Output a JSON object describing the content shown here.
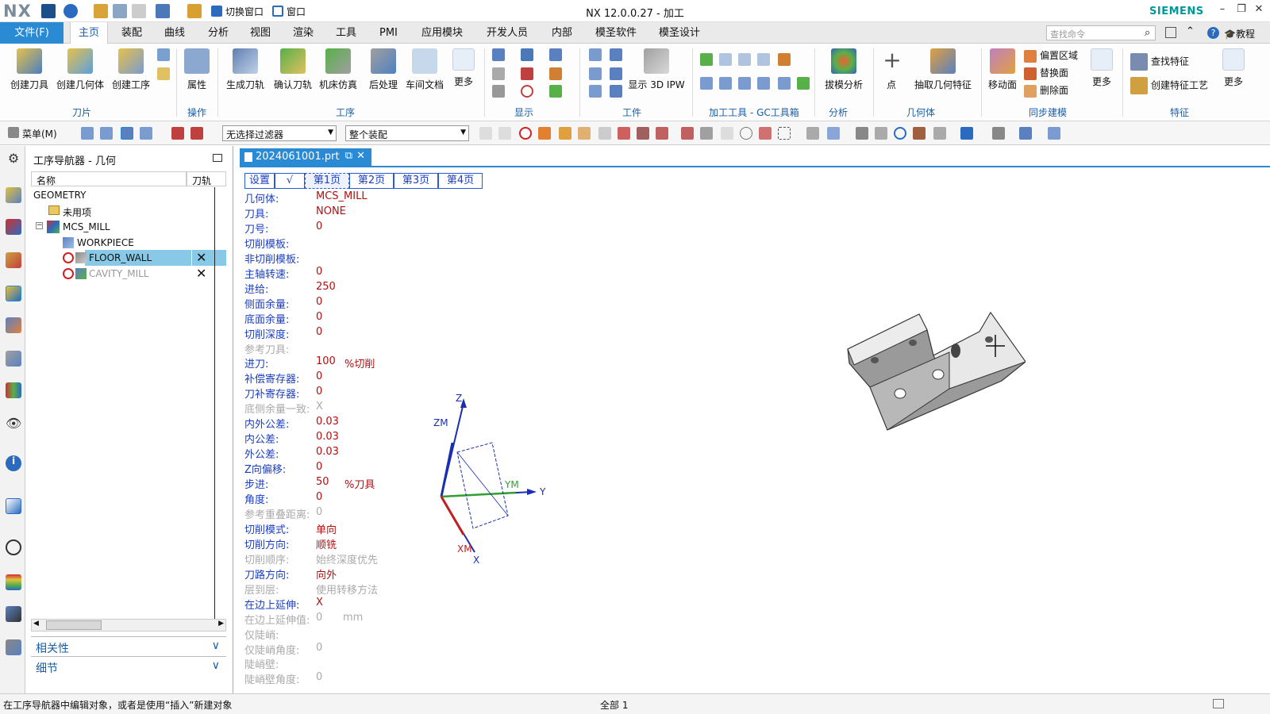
{
  "window": {
    "logo": "NX",
    "title": "NX 12.0.0.27 - 加工",
    "brand": "SIEMENS",
    "quick_switch_window": "切换窗口",
    "quick_window": "窗口"
  },
  "menu": {
    "file": "文件(F)",
    "tabs": [
      "主页",
      "装配",
      "曲线",
      "分析",
      "视图",
      "渲染",
      "工具",
      "PMI",
      "应用模块",
      "开发人员",
      "内部",
      "模圣软件",
      "模圣设计"
    ],
    "active_tab": "主页",
    "search_placeholder": "查找命令",
    "tutorial": "教程"
  },
  "ribbon": {
    "buttons": {
      "create_tool": "创建刀具",
      "create_geometry": "创建几何体",
      "create_operation": "创建工序",
      "properties": "属性",
      "generate_path": "生成刀轨",
      "verify_path": "确认刀轨",
      "machine_sim": "机床仿真",
      "postprocess": "后处理",
      "shop_doc": "车间文档",
      "more1": "更多",
      "show_3d_ipw": "显示 3D IPW",
      "draft_analysis": "拔模分析",
      "point": "点",
      "extract_geometry": "抽取几何特征",
      "move_face": "移动面",
      "offset_region": "偏置区域",
      "replace_face": "替换面",
      "delete_face": "删除面",
      "more2": "更多",
      "find_feature": "查找特征",
      "create_feature_process": "创建特征工艺",
      "more3": "更多"
    },
    "groups": [
      "刀片",
      "操作",
      "工序",
      "显示",
      "工件",
      "加工工具 - GC工具箱",
      "分析",
      "几何体",
      "同步建模",
      "特征"
    ]
  },
  "toolbar2": {
    "menu_label": "菜单(M)",
    "filter": "无选择过滤器",
    "scope": "整个装配"
  },
  "navigator": {
    "title": "工序导航器 - 几何",
    "col_name": "名称",
    "col_path": "刀轨",
    "items": [
      {
        "name": "GEOMETRY",
        "path": ""
      },
      {
        "name": "未用项",
        "path": ""
      },
      {
        "name": "MCS_MILL",
        "path": ""
      },
      {
        "name": "WORKPIECE",
        "path": ""
      },
      {
        "name": "FLOOR_WALL",
        "path": "✕"
      },
      {
        "name": "CAVITY_MILL",
        "path": "✕"
      }
    ],
    "accordion": [
      "相关性",
      "细节"
    ]
  },
  "document": {
    "tab": "2024061001.prt"
  },
  "params": {
    "tabs": [
      "设置",
      "√",
      "第1页",
      "第2页",
      "第3页",
      "第4页"
    ],
    "rows": [
      {
        "label": "几何体:",
        "value": "MCS_MILL",
        "unit": "",
        "gray": false
      },
      {
        "label": "刀具:",
        "value": "NONE",
        "unit": "",
        "gray": false
      },
      {
        "label": "刀号:",
        "value": "0",
        "unit": "",
        "gray": false
      },
      {
        "label": "切削模板:",
        "value": "",
        "unit": "",
        "gray": false
      },
      {
        "label": "非切削模板:",
        "value": "",
        "unit": "",
        "gray": false
      },
      {
        "label": "主轴转速:",
        "value": "0",
        "unit": "",
        "gray": false
      },
      {
        "label": "进给:",
        "value": "250",
        "unit": "",
        "gray": false
      },
      {
        "label": "侧面余量:",
        "value": "0",
        "unit": "",
        "gray": false
      },
      {
        "label": "底面余量:",
        "value": "0",
        "unit": "",
        "gray": false
      },
      {
        "label": "切削深度:",
        "value": "0",
        "unit": "",
        "gray": false
      },
      {
        "label": "参考刀具:",
        "value": "",
        "unit": "",
        "gray": true
      },
      {
        "label": "进刀:",
        "value": "100",
        "unit": "%切削",
        "gray": false
      },
      {
        "label": "补偿寄存器:",
        "value": "0",
        "unit": "",
        "gray": false
      },
      {
        "label": "刀补寄存器:",
        "value": "0",
        "unit": "",
        "gray": false
      },
      {
        "label": "底侧余量一致:",
        "value": "X",
        "unit": "",
        "gray": true
      },
      {
        "label": "内外公差:",
        "value": "0.03",
        "unit": "",
        "gray": false
      },
      {
        "label": "内公差:",
        "value": "0.03",
        "unit": "",
        "gray": false
      },
      {
        "label": "外公差:",
        "value": "0.03",
        "unit": "",
        "gray": false
      },
      {
        "label": "Z向偏移:",
        "value": "0",
        "unit": "",
        "gray": false
      },
      {
        "label": "步进:",
        "value": "50",
        "unit": "%刀具",
        "gray": false
      },
      {
        "label": "角度:",
        "value": "0",
        "unit": "",
        "gray": false
      },
      {
        "label": "参考重叠距离:",
        "value": "0",
        "unit": "",
        "gray": true
      },
      {
        "label": "切削模式:",
        "value": "单向",
        "unit": "",
        "gray": false
      },
      {
        "label": "切削方向:",
        "value": "顺铣",
        "unit": "",
        "gray": false
      },
      {
        "label": "切削顺序:",
        "value": "始终深度优先",
        "unit": "",
        "gray": true
      },
      {
        "label": "刀路方向:",
        "value": "向外",
        "unit": "",
        "gray": false
      },
      {
        "label": "层到层:",
        "value": "使用转移方法",
        "unit": "",
        "gray": true
      },
      {
        "label": "在边上延伸:",
        "value": "X",
        "unit": "",
        "gray": false
      },
      {
        "label": "在边上延伸值:",
        "value": "0",
        "unit": "mm",
        "gray": true
      },
      {
        "label": "仅陡峭:",
        "value": "",
        "unit": "",
        "gray": true
      },
      {
        "label": "仅陡峭角度:",
        "value": "0",
        "unit": "",
        "gray": true
      },
      {
        "label": "陡峭壁:",
        "value": "",
        "unit": "",
        "gray": true
      },
      {
        "label": "陡峭壁角度:",
        "value": "0",
        "unit": "",
        "gray": true
      }
    ]
  },
  "axes": {
    "z": "Z",
    "zm": "ZM",
    "y": "Y",
    "ym": "YM",
    "x": "X",
    "xm": "XM"
  },
  "status": {
    "message": "在工序导航器中编辑对象，或者是使用“插入”新建对象",
    "selection": "全部 1"
  }
}
